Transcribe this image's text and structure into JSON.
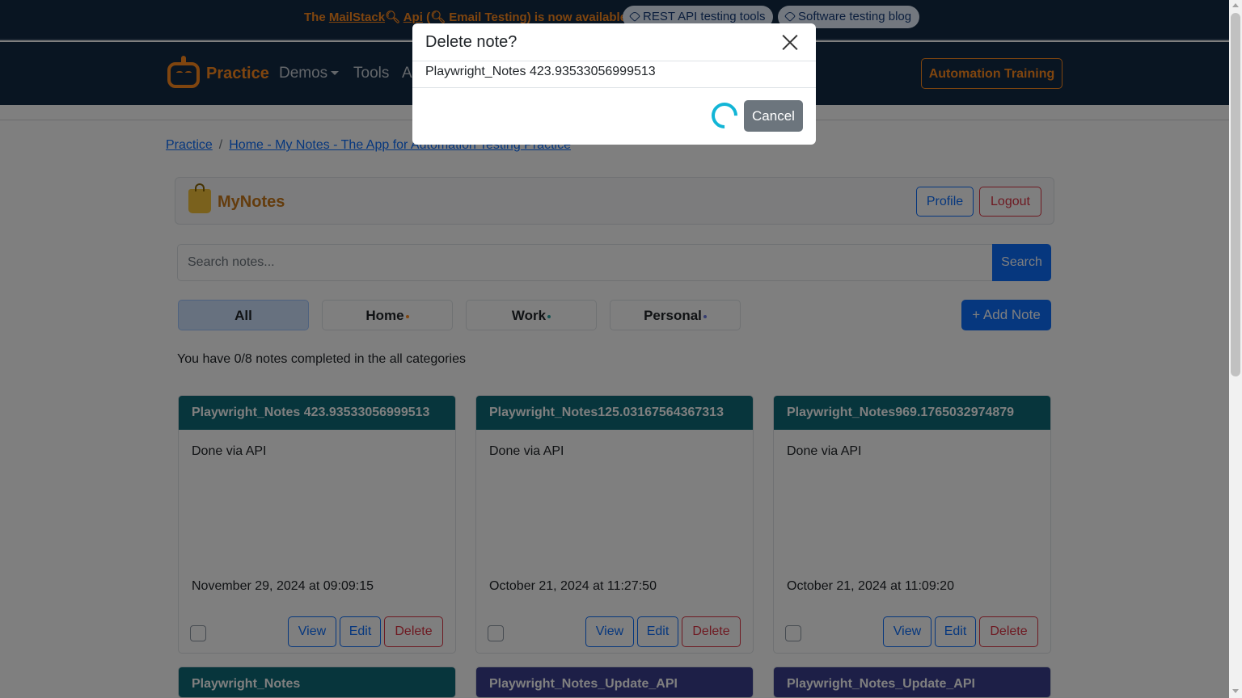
{
  "announcement": {
    "prefix": "The",
    "mailstack_link": "MailStack",
    "api_link": "Api",
    "rest": "(",
    "rest2": "Email Testing) is now available!",
    "pill1": "REST API testing tools",
    "pill2": "Software testing blog"
  },
  "nav": {
    "brand": "Practice",
    "demos": "Demos",
    "tools": "Tools",
    "hidden_link": "A",
    "training": "Automation Training"
  },
  "breadcrumb": {
    "root": "Practice",
    "separator": "/",
    "current": "Home - My Notes - The App for Automation Testing Practice"
  },
  "header": {
    "title": "MyNotes",
    "profile": "Profile",
    "logout": "Logout"
  },
  "search": {
    "placeholder": "Search notes...",
    "button": "Search"
  },
  "categories": [
    {
      "label": "All",
      "dot_color": ""
    },
    {
      "label": "Home",
      "dot_color": "#ff8a1e"
    },
    {
      "label": "Work",
      "dot_color": "#2ca6a4"
    },
    {
      "label": "Personal",
      "dot_color": "#6c7ae0"
    }
  ],
  "add_note": "+ Add Note",
  "progress": "You have 0/8 notes completed in the all categories",
  "cards": [
    {
      "title": "Playwright_Notes 423.93533056999513",
      "description": "Done via API",
      "date": "November 29, 2024 at 09:09:15",
      "view": "View",
      "edit": "Edit",
      "delete": "Delete",
      "header_color": "#0f6b78"
    },
    {
      "title": "Playwright_Notes125.03167564367313",
      "description": "Done via API",
      "date": "October 21, 2024 at 11:27:50",
      "view": "View",
      "edit": "Edit",
      "delete": "Delete",
      "header_color": "#0f6b78"
    },
    {
      "title": "Playwright_Notes969.1765032974879",
      "description": "Done via API",
      "date": "October 21, 2024 at 11:09:20",
      "view": "View",
      "edit": "Edit",
      "delete": "Delete",
      "header_color": "#0f6b78"
    },
    {
      "title": "Playwright_Notes",
      "header_color": "#0f6b78"
    },
    {
      "title": "Playwright_Notes_Update_API",
      "header_color": "#3b3f8f"
    },
    {
      "title": "Playwright_Notes_Update_API",
      "header_color": "#3b3f8f"
    }
  ],
  "modal": {
    "title": "Delete note?",
    "body": "Playwright_Notes 423.93533056999513",
    "cancel": "Cancel"
  }
}
